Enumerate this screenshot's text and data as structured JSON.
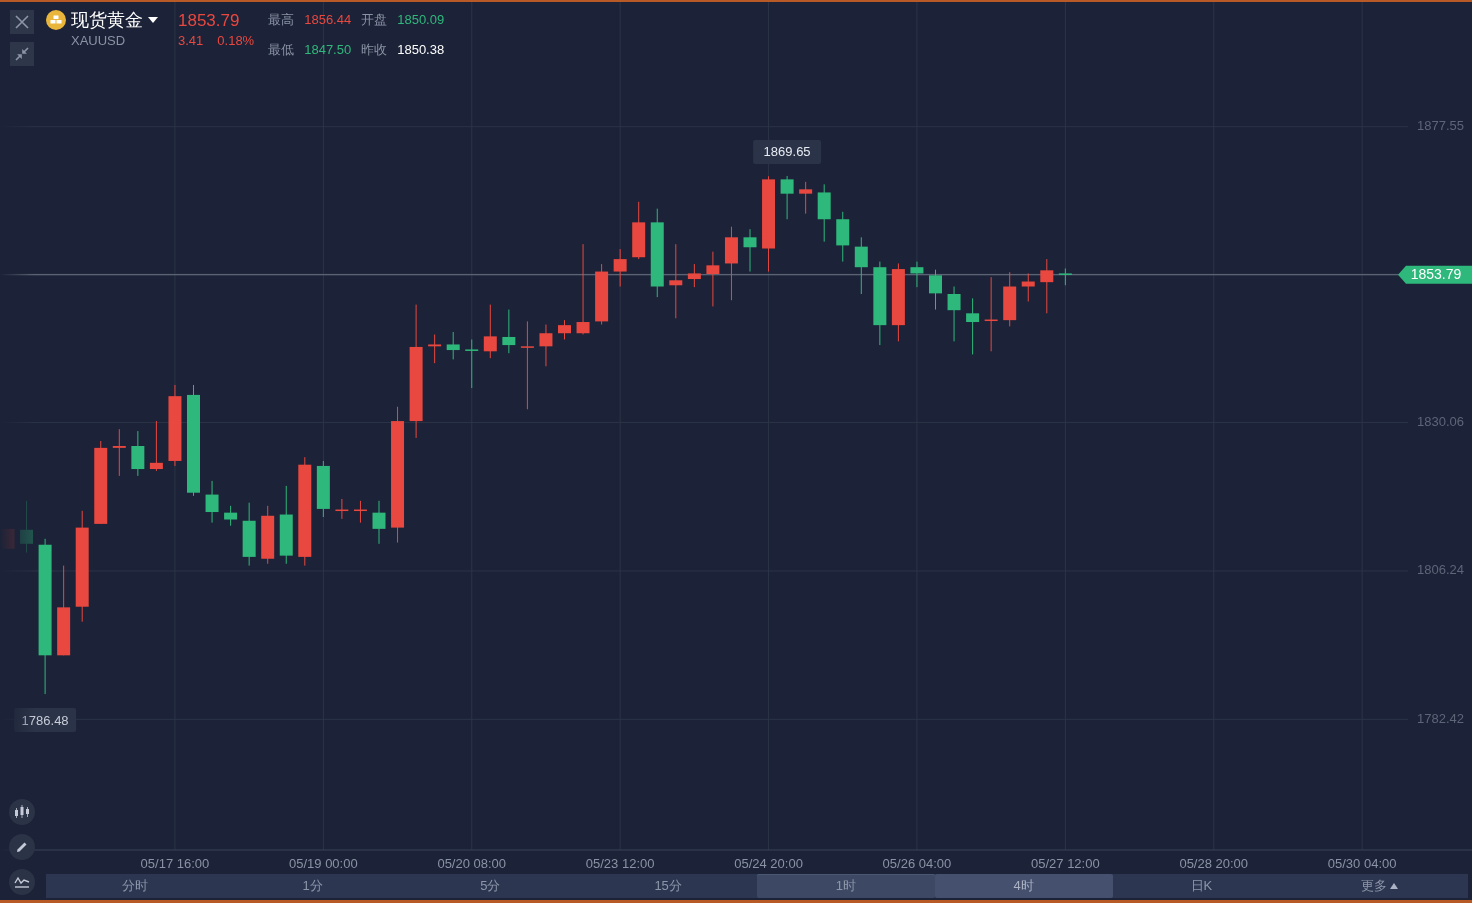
{
  "header": {
    "symbol_name": "现货黄金",
    "symbol_code": "XAUUSD",
    "price": "1853.79",
    "change": "3.41",
    "change_percent": "0.18%",
    "rising": true,
    "stats": [
      {
        "label": "最高",
        "value": "1856.44",
        "color": "#e8483f"
      },
      {
        "label": "开盘",
        "value": "1850.09",
        "color": "#2fb87b"
      },
      {
        "label": "最低",
        "value": "1847.50",
        "color": "#2fb87b"
      },
      {
        "label": "昨收",
        "value": "1850.38",
        "color": "#ffffff"
      }
    ]
  },
  "chart": {
    "current_price": "1853.79",
    "max_label": "1869.65",
    "min_label": "1786.48",
    "y_labels": [
      "1877.55",
      "1830.06",
      "1806.24",
      "1782.42"
    ],
    "x_labels": [
      "05/17 16:00",
      "05/19 00:00",
      "05/20 08:00",
      "05/23 12:00",
      "05/24 20:00",
      "05/26 04:00",
      "05/27 12:00",
      "05/28 20:00",
      "05/30 04:00"
    ]
  },
  "tools": [
    {
      "kind": "candles"
    },
    {
      "kind": "pencil"
    },
    {
      "kind": "indicator"
    }
  ],
  "periods": [
    {
      "label": "分时",
      "selected": false,
      "highlighted": false
    },
    {
      "label": "1分",
      "selected": false,
      "highlighted": false
    },
    {
      "label": "5分",
      "selected": false,
      "highlighted": false
    },
    {
      "label": "15分",
      "selected": false,
      "highlighted": false
    },
    {
      "label": "1时",
      "selected": false,
      "highlighted": true
    },
    {
      "label": "4时",
      "selected": true,
      "highlighted": false
    },
    {
      "label": "日K",
      "selected": false,
      "highlighted": false
    },
    {
      "label": "更多",
      "selected": false,
      "highlighted": false,
      "kind": "more"
    }
  ]
}
